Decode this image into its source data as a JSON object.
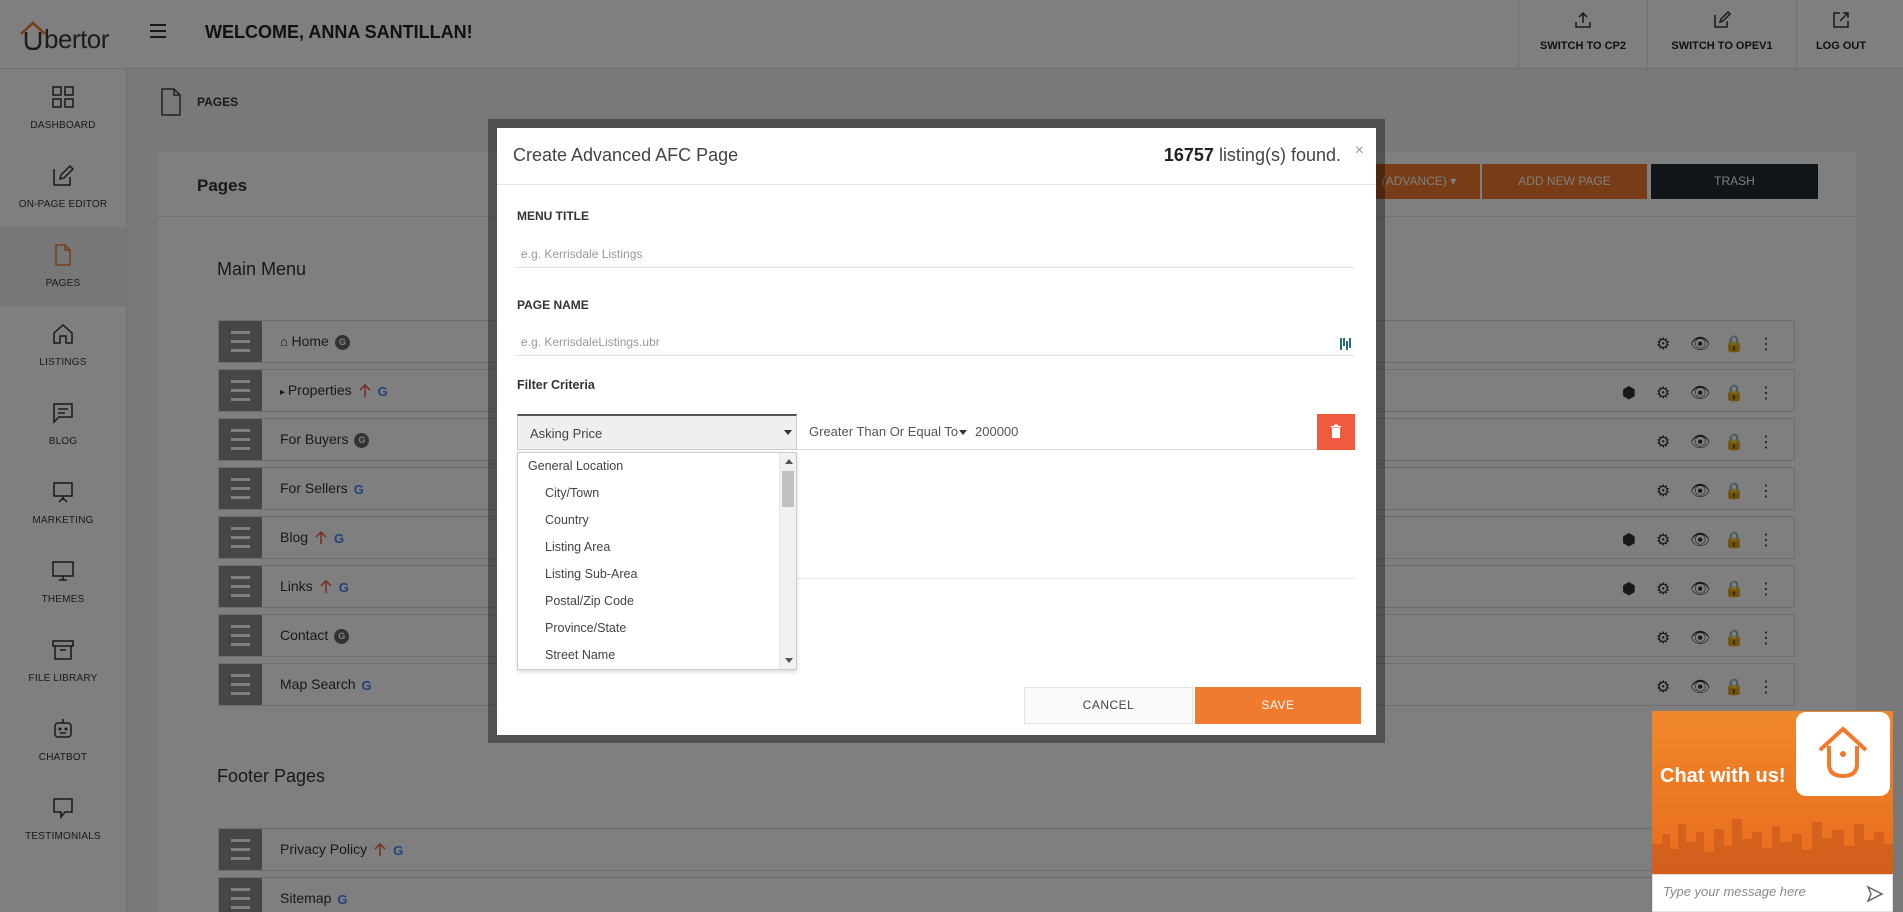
{
  "app": {
    "logo_text": "bertor",
    "welcome": "WELCOME, ANNA SANTILLAN!"
  },
  "top_actions": [
    {
      "label": "SWITCH TO CP2",
      "icon": "upload-icon"
    },
    {
      "label": "SWITCH TO OPEV1",
      "icon": "edit-icon"
    },
    {
      "label": "LOG OUT",
      "icon": "external-link-icon"
    }
  ],
  "sidebar": {
    "items": [
      {
        "label": "DASHBOARD",
        "icon": "grid-icon"
      },
      {
        "label": "ON-PAGE EDITOR",
        "icon": "edit-icon"
      },
      {
        "label": "PAGES",
        "icon": "page-icon",
        "active": true
      },
      {
        "label": "LISTINGS",
        "icon": "house-icon"
      },
      {
        "label": "BLOG",
        "icon": "comment-icon"
      },
      {
        "label": "MARKETING",
        "icon": "presentation-icon"
      },
      {
        "label": "THEMES",
        "icon": "monitor-icon"
      },
      {
        "label": "FILE LIBRARY",
        "icon": "archive-icon"
      },
      {
        "label": "CHATBOT",
        "icon": "robot-icon"
      },
      {
        "label": "TESTIMONIALS",
        "icon": "chat-bubble-icon"
      }
    ]
  },
  "breadcrumb": {
    "label": "PAGES"
  },
  "panel": {
    "title": "Pages",
    "buttons": {
      "advance": "(ADVANCE)",
      "add_new": "ADD NEW PAGE",
      "trash": "TRASH"
    },
    "main_menu_title": "Main Menu",
    "footer_title": "Footer Pages",
    "main_menu": [
      {
        "label": "Home"
      },
      {
        "label": "Properties"
      },
      {
        "label": "For Buyers"
      },
      {
        "label": "For Sellers"
      },
      {
        "label": "Blog"
      },
      {
        "label": "Links"
      },
      {
        "label": "Contact"
      },
      {
        "label": "Map Search"
      }
    ],
    "footer": [
      {
        "label": "Privacy Policy"
      },
      {
        "label": "Sitemap"
      }
    ]
  },
  "modal": {
    "title": "Create Advanced AFC Page",
    "count": "16757",
    "count_suffix": " listing(s) found.",
    "close": "×",
    "menu_title_label": "MENU TITLE",
    "menu_title_placeholder": "e.g. Kerrisdale Listings",
    "page_name_label": "PAGE NAME",
    "page_name_placeholder": "e.g. KerrisdaleListings.ubr",
    "filter_label": "Filter Criteria",
    "filter_field": "Asking Price",
    "filter_operator": "Greater Than Or Equal To",
    "filter_value": "200000",
    "dropdown": [
      {
        "label": "General Location",
        "group": true
      },
      {
        "label": "City/Town"
      },
      {
        "label": "Country"
      },
      {
        "label": "Listing Area"
      },
      {
        "label": "Listing Sub-Area"
      },
      {
        "label": "Postal/Zip Code"
      },
      {
        "label": "Province/State"
      },
      {
        "label": "Street Name"
      }
    ],
    "cancel": "CANCEL",
    "save": "SAVE"
  },
  "chat": {
    "title": "Chat with us!",
    "placeholder": "Type your message here"
  },
  "colors": {
    "accent": "#f07a2e",
    "danger": "#f05a3e",
    "dark": "#1f2a33"
  }
}
